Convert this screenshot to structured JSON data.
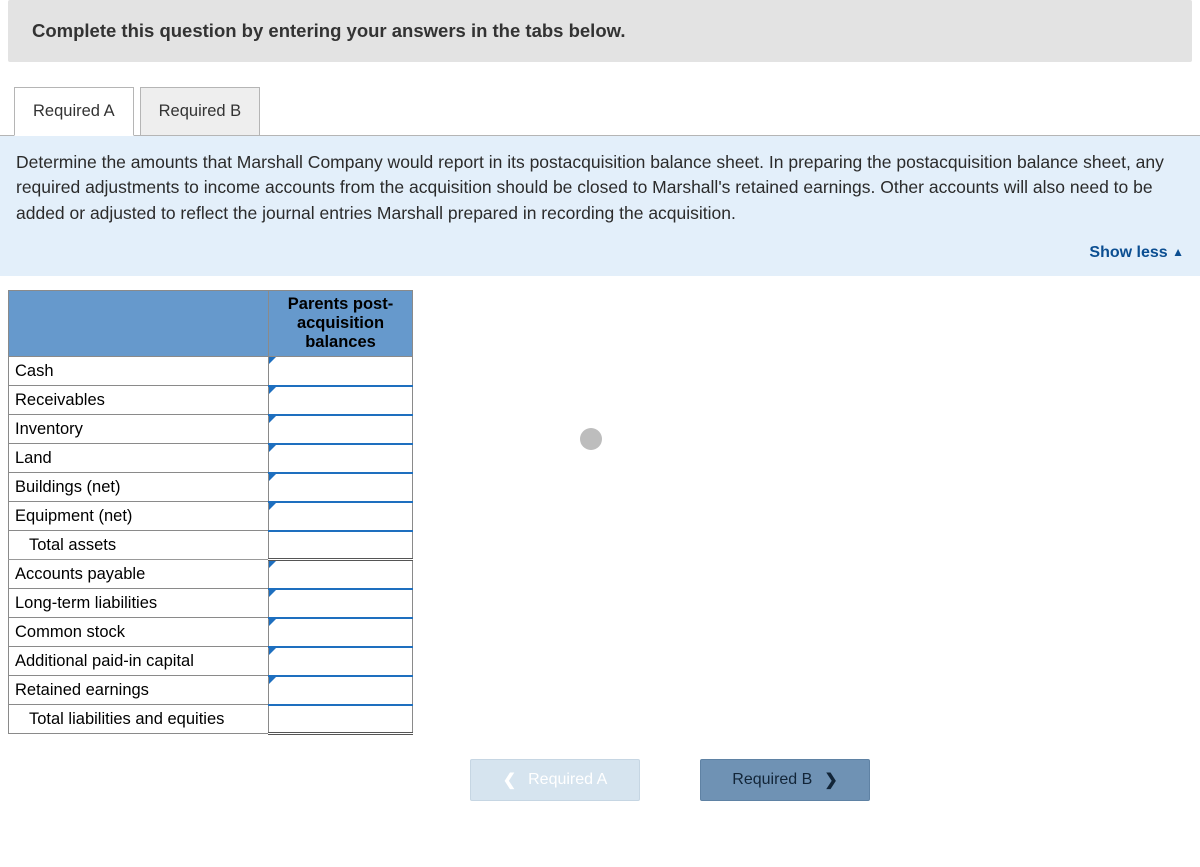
{
  "instruction": "Complete this question by entering your answers in the tabs below.",
  "tabs": {
    "a": "Required A",
    "b": "Required B"
  },
  "prompt": "Determine the amounts that Marshall Company would report in its postacquisition balance sheet. In preparing the postacquisition balance sheet, any required adjustments to income accounts from the acquisition should be closed to Marshall's retained earnings. Other accounts will also need to be added or adjusted to reflect the journal entries Marshall prepared in recording the acquisition.",
  "show_less": "Show less",
  "column_header": "Parents post-\nacquisition\nbalances",
  "rows": {
    "cash": "Cash",
    "receivables": "Receivables",
    "inventory": "Inventory",
    "land": "Land",
    "buildings": "Buildings (net)",
    "equipment": "Equipment (net)",
    "total_assets": "Total assets",
    "ap": "Accounts payable",
    "ltl": "Long-term liabilities",
    "cs": "Common stock",
    "apic": "Additional paid-in capital",
    "re": "Retained earnings",
    "total_le": "Total liabilities and equities"
  },
  "nav": {
    "prev": "Required A",
    "next": "Required B"
  }
}
